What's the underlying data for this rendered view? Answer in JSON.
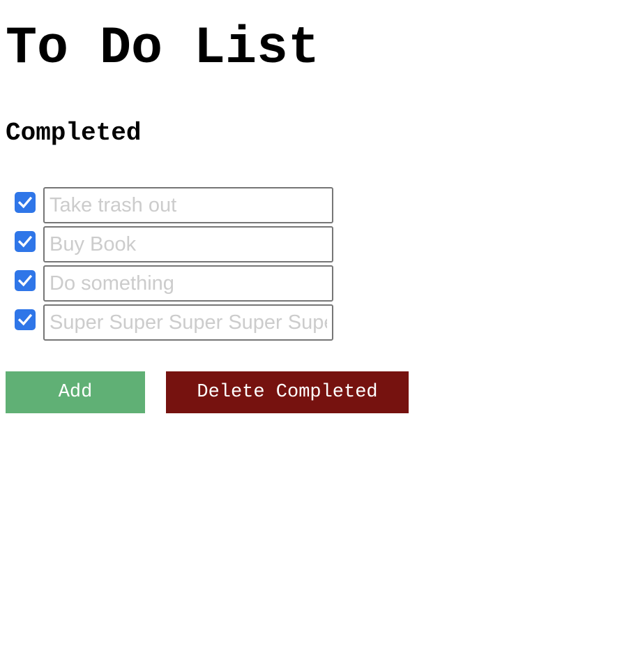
{
  "page": {
    "title": "To Do List",
    "section_heading": "Completed"
  },
  "todos": [
    {
      "placeholder": "Take trash out",
      "value": "",
      "checked": true
    },
    {
      "placeholder": "Buy Book",
      "value": "",
      "checked": true
    },
    {
      "placeholder": "Do something",
      "value": "",
      "checked": true
    },
    {
      "placeholder": "Super Super Super Super Super",
      "value": "",
      "checked": true
    }
  ],
  "actions": {
    "add_label": "Add",
    "delete_completed_label": "Delete Completed"
  },
  "colors": {
    "checkbox": "#2f76e8",
    "checkmark": "#ffffff",
    "placeholder_text": "#cccccc",
    "field_border": "#767676",
    "add_button": "#60b075",
    "delete_button": "#76120f"
  },
  "icons": {
    "checkbox": "checkmark-icon"
  }
}
